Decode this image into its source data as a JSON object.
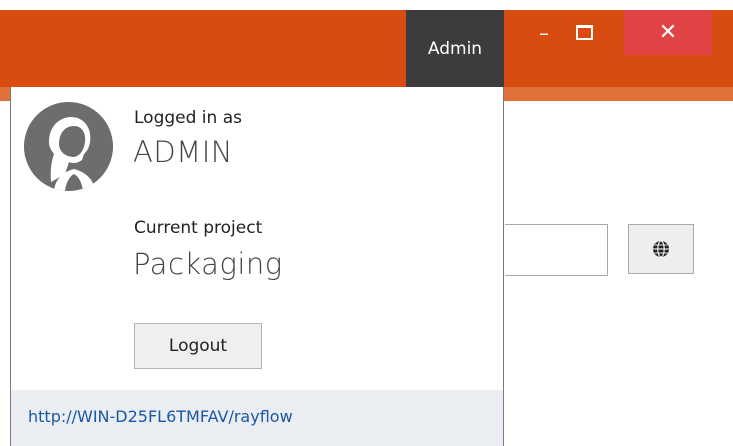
{
  "titlebar": {
    "user_button_label": "Admin",
    "accent_color": "#d84c12",
    "user_button_color": "#3c3c3c",
    "close_button_color": "#e04343",
    "controls": {
      "minimize_icon": "minimize-icon",
      "maximize_icon": "maximize-icon",
      "close_glyph": "✕"
    }
  },
  "background": {
    "globe_icon": "globe-icon"
  },
  "user_popup": {
    "logged_in_label": "Logged in as",
    "username": "ADMIN",
    "project_label": "Current project",
    "project_name": "Packaging",
    "logout_label": "Logout",
    "server_url": "http://WIN-D25FL6TMFAV/rayflow",
    "avatar_icon": "user-avatar-icon"
  }
}
